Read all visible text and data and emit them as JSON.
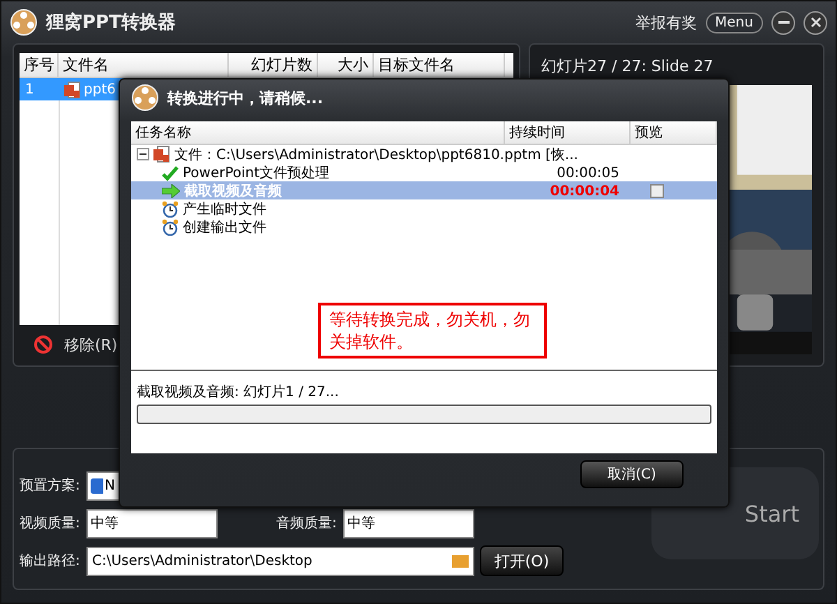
{
  "window": {
    "title": "狸窝PPT转换器",
    "report_link": "举报有奖",
    "menu_button": "Menu"
  },
  "file_list": {
    "columns": [
      "序号",
      "文件名",
      "幻灯片数",
      "大小",
      "目标文件名"
    ],
    "rows": [
      {
        "index": "1",
        "name": "ppt6",
        "selected": true
      }
    ],
    "remove_button": "移除(R)"
  },
  "preview": {
    "caption": "幻灯片27 / 27: Slide 27",
    "kind": "picture"
  },
  "settings": {
    "preset_label": "预置方案:",
    "preset_value": "N",
    "video_quality_label": "视频质量:",
    "video_quality": "中等",
    "audio_quality_label": "音频质量:",
    "audio_quality": "中等",
    "output_label": "输出路径:",
    "output_path": "C:\\Users\\Administrator\\Desktop",
    "open_button": "打开(O)",
    "start_button": "Start"
  },
  "dialog": {
    "title": "转换进行中，请稍候...",
    "columns": [
      "任务名称",
      "持续时间",
      "预览"
    ],
    "tree": {
      "label": "文件：C:\\Users\\Administrator\\Desktop\\ppt6810.pptm [恢...",
      "expanded": true,
      "children": [
        {
          "kind": "done",
          "label": "PowerPoint文件预处理",
          "duration": "00:00:05",
          "selected": false
        },
        {
          "kind": "current",
          "label": "截取视频及音频",
          "duration": "00:00:04",
          "selected": true,
          "preview_checked": false
        },
        {
          "kind": "pending",
          "label": "产生临时文件",
          "selected": false
        },
        {
          "kind": "pending",
          "label": "创建输出文件",
          "selected": false
        }
      ]
    },
    "notice": "等待转换完成，勿关机，勿关掉软件。",
    "status": "截取视频及音频: 幻灯片1 / 27...",
    "progress": {
      "level": 0
    },
    "cancel_button": "取消(C)"
  }
}
